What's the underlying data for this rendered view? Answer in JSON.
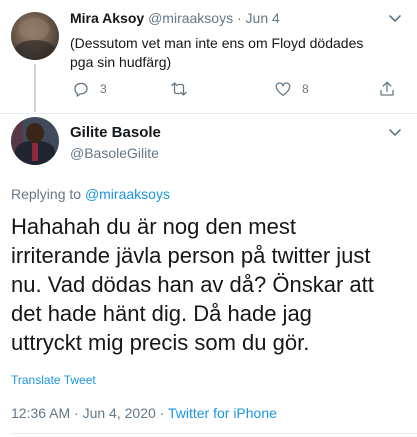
{
  "parent_tweet": {
    "name": "Mira Aksoy",
    "handle": "@miraaksoys",
    "separator": "·",
    "date": "Jun 4",
    "text_lines": [
      "(Dessutom vet man inte ens om Floyd dödades",
      "pga sin hudfärg)"
    ],
    "actions": {
      "reply_count": "3",
      "retweet_count": "",
      "like_count": "8"
    }
  },
  "main_tweet": {
    "name": "Gilite Basole",
    "handle": "@BasoleGilite",
    "replying_to_label": "Replying to",
    "replying_to_handle": "@miraaksoys",
    "text_lines": [
      "Hahahah du är nog den mest",
      "irriterande jävla person på twitter just",
      "nu. Vad dödas han av då? Önskar att",
      "det hade hänt dig. Då hade jag",
      "uttryckt mig precis som du gör."
    ],
    "translate_label": "Translate Tweet",
    "timestamp": "12:36 AM · Jun 4, 2020 ·",
    "source": "Twitter for iPhone"
  },
  "colors": {
    "link": "#1b95e0",
    "secondary_text": "#657786",
    "primary_text": "#14171a",
    "divider": "#e6ecf0"
  },
  "icons": [
    "chevron-down-icon",
    "reply-icon",
    "retweet-icon",
    "like-icon",
    "share-icon"
  ]
}
